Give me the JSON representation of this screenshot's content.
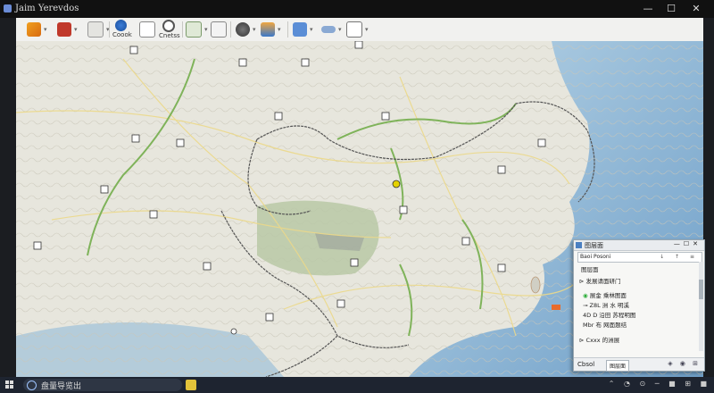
{
  "window": {
    "title": "Jaim Yerevdos",
    "controls": {
      "minimize": "—",
      "maximize": "☐",
      "close": "✕"
    }
  },
  "toolbar": {
    "items": [
      {
        "icon": "pencil-icon",
        "label": ""
      },
      {
        "icon": "layers-icon",
        "label": ""
      },
      {
        "icon": "expand-icon",
        "label": ""
      },
      {
        "icon": "globe-icon",
        "label": "Coook"
      },
      {
        "icon": "chart-icon",
        "label": ""
      },
      {
        "icon": "gear-icon",
        "label": "Cnetss"
      },
      {
        "icon": "play-icon",
        "label": ""
      },
      {
        "icon": "needle-icon",
        "label": ""
      },
      {
        "icon": "compass-icon",
        "label": ""
      },
      {
        "icon": "upload-icon",
        "label": ""
      },
      {
        "icon": "grid-icon",
        "label": ""
      },
      {
        "icon": "link-icon",
        "label": ""
      },
      {
        "icon": "options-icon",
        "label": ""
      }
    ]
  },
  "map": {
    "scale_label": "⊢——⊣———"
  },
  "panel": {
    "title": "图层面",
    "search": {
      "value": "Baoi Posoni",
      "actions": "↓ ↑ ≡"
    },
    "section": "图层面",
    "rows": [
      {
        "prefix": "⊳",
        "text": "发展请面研门"
      },
      {
        "prefix": "◉",
        "text": "展金 乘林图面"
      },
      {
        "prefix": "⊸",
        "text": "Z8L 洲  水 明溪"
      },
      {
        "prefix": "4D",
        "text": "D 沿田  苏程明图"
      },
      {
        "prefix": "Mbr",
        "text": "布   网面题结"
      },
      {
        "prefix": "⊳",
        "text": "Cxxx 的洲展"
      }
    ],
    "footer": {
      "left": "Cbsol",
      "button": "图层面",
      "icons": "◈ ◉ ⊞"
    },
    "colors": {
      "accent": "#4a7fc1",
      "marker": "#2fae3c"
    }
  },
  "taskbar": {
    "search_text": "盘量导览出",
    "tray": "⌃ ◔ ⊙ ─ ■ ⊞ ■"
  }
}
